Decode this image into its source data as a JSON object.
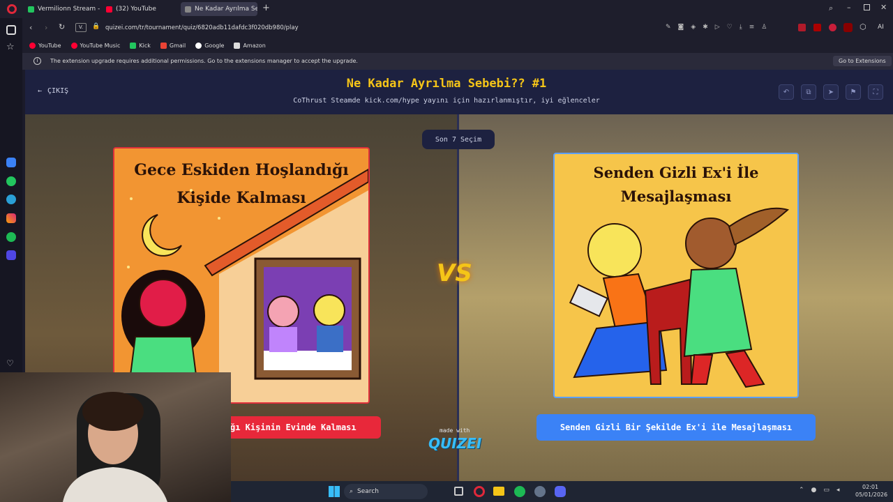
{
  "browser": {
    "tabs": [
      {
        "label": "Vermilionn Stream - Watc",
        "color": "#22c55e"
      },
      {
        "label": "(32) YouTube",
        "color": "#ff0033"
      },
      {
        "label": "Ne Kadar Ayrılma Sebebi...",
        "color": "#888888",
        "active": true
      }
    ],
    "url": "quizei.com/tr/tournament/quiz/6820adb11dafdc3f020db980/play",
    "url_prefix": "V.",
    "bookmarks": [
      "YouTube",
      "YouTube Music",
      "Kick",
      "Gmail",
      "Google",
      "Amazon"
    ],
    "infobar_text": "The extension upgrade requires additional permissions. Go to the extensions manager to accept the upgrade.",
    "infobar_button": "Go to Extensions",
    "ai_label": "AI"
  },
  "quiz": {
    "exit_label": "ÇIKIŞ",
    "title": "Ne Kadar Ayrılma Sebebi?? #1",
    "subtitle": "CoThrust Steamde kick.com/hype yayını için hazırlanmıştır, iyi eğlenceler",
    "round_label": "Son 7 Seçim",
    "vs_label": "VS",
    "left": {
      "card_title_line1": "Gece Eskiden Hoşlandığı",
      "card_title_line2": "Kişide Kalması",
      "choice_label": "ğı Kişinin Evinde Kalması",
      "accent": "#e8283a"
    },
    "right": {
      "card_title_line1": "Senden Gizli Ex'i İle",
      "card_title_line2": "Mesajlaşması",
      "choice_label": "Senden Gizli Bir Şekilde Ex'i ile Mesajlaşması",
      "accent": "#3b82f6"
    },
    "made_with": "made with",
    "brand": "QUIZEI"
  },
  "taskbar": {
    "search_label": "Search",
    "time": "02:01",
    "date": "05/01/2026"
  }
}
